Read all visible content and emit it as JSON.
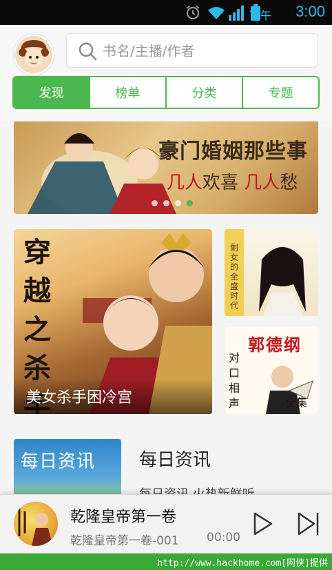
{
  "status_bar": {
    "ampm": "下午",
    "time": "3:00"
  },
  "search": {
    "placeholder": "书名/主播/作者"
  },
  "tabs": [
    {
      "label": "发现",
      "active": true
    },
    {
      "label": "榜单",
      "active": false
    },
    {
      "label": "分类",
      "active": false
    },
    {
      "label": "专题",
      "active": false
    }
  ],
  "banner": {
    "title": "豪门婚姻那些事",
    "sub_a": "几人",
    "sub_b": "欢喜",
    "sub_c": "几人",
    "sub_d": "愁",
    "dots_total": 4,
    "dots_active_index": 3
  },
  "featured": {
    "main": {
      "cover_title": "穿越之杀手弃妃",
      "caption": "美女杀手困冷宫"
    },
    "side_top": {
      "cover_text": "剩女的全盛时代"
    },
    "side_bottom": {
      "title": "郭德纲",
      "vertical": "对口相声",
      "full": "全集"
    }
  },
  "news": {
    "thumb_text": "每日资讯",
    "title": "每日资讯",
    "desc": "每日资讯 火热新鲜听"
  },
  "player": {
    "title": "乾隆皇帝第一卷",
    "subtitle": "乾隆皇帝第一卷-001",
    "time": "00:00"
  },
  "footer": {
    "watermark": "http://www.hackhome.com[网侠]提供"
  },
  "colors": {
    "accent": "#4ab84e",
    "status_time": "#2fb8e6"
  }
}
